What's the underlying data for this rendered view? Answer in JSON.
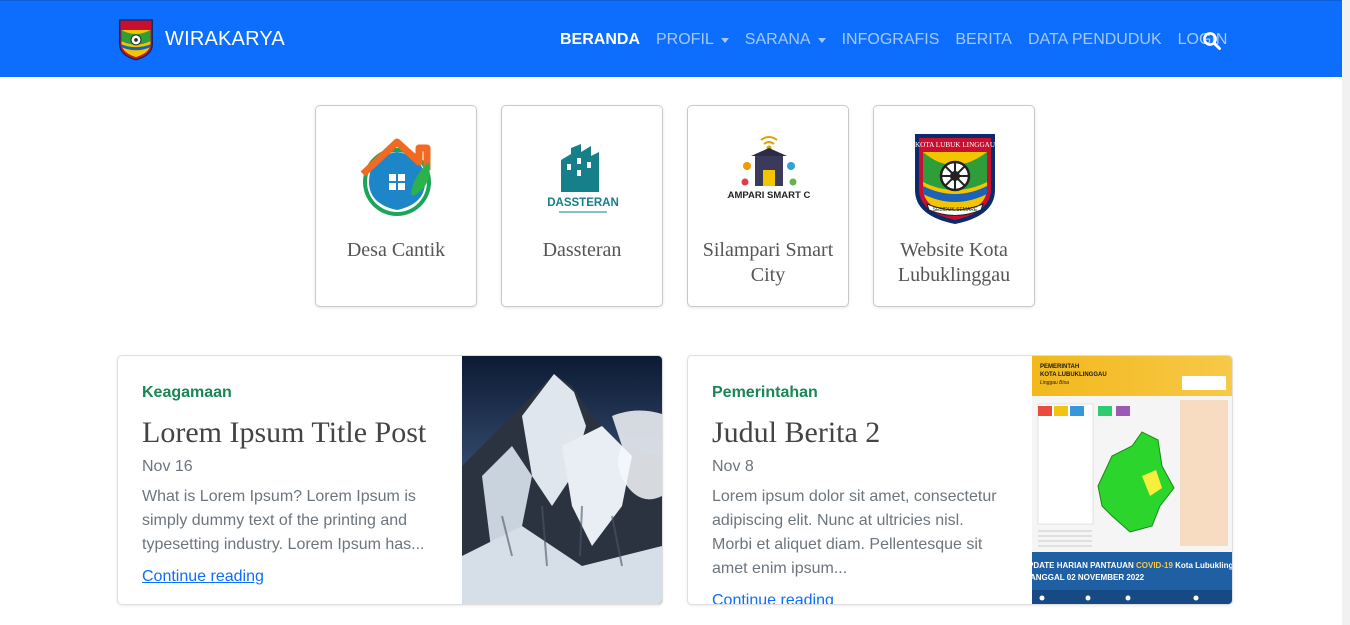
{
  "brand": {
    "name": "WIRAKARYA",
    "logo_icon": "city-crest-icon"
  },
  "nav": {
    "items": [
      {
        "label": "BERANDA",
        "active": true,
        "dropdown": false
      },
      {
        "label": "PROFIL",
        "active": false,
        "dropdown": true
      },
      {
        "label": "SARANA",
        "active": false,
        "dropdown": true
      },
      {
        "label": "INFOGRAFIS",
        "active": false,
        "dropdown": false
      },
      {
        "label": "BERITA",
        "active": false,
        "dropdown": false
      },
      {
        "label": "DATA PENDUDUK",
        "active": false,
        "dropdown": false
      },
      {
        "label": "LOGIN",
        "active": false,
        "dropdown": false
      }
    ],
    "search_icon": "search-icon"
  },
  "apps": [
    {
      "label": "Desa Cantik",
      "icon": "house-leaf-icon"
    },
    {
      "label": "Dassteran",
      "icon": "dassteran-logo-icon",
      "logo_text": "DASSTERAN"
    },
    {
      "label": "Silampari Smart City",
      "icon": "smart-city-icon",
      "logo_text": "SILAMPARI SMART CITY"
    },
    {
      "label": "Website Kota Lubuklinggau",
      "icon": "city-crest-icon",
      "logo_text": "KOTA LUBUK LINGGAU",
      "motto": "SEBIDUK SEMARE"
    }
  ],
  "posts": [
    {
      "category": "Keagamaan",
      "title": "Lorem Ipsum Title Post",
      "date": "Nov 16",
      "excerpt": "What is Lorem Ipsum? Lorem Ipsum is simply dummy text of the printing and typesetting industry. Lorem Ipsum has...",
      "link": "Continue reading",
      "image": "mountain-photo"
    },
    {
      "category": "Pemerintahan",
      "title": "Judul Berita 2",
      "date": "Nov 8",
      "excerpt": "Lorem ipsum dolor sit amet, consectetur adipiscing elit. Nunc at ultricies nisl. Morbi et aliquet diam. Pellentesque sit amet enim ipsum...",
      "link": "Continue reading",
      "image": "covid-infographic-map",
      "image_text": {
        "heading1": "PEMERINTAH",
        "heading2": "KOTA LUBUKLINGGAU",
        "motto": "Linggau Bisa",
        "banner1_a": "PDATE HARIAN PANTAUAN ",
        "banner1_b": "COVID-19",
        "banner1_c": " Kota Lubuklingg",
        "banner2": "ANGGAL 02 NOVEMBER 2022"
      }
    }
  ],
  "colors": {
    "navbar": "#0d6efd",
    "category": "#198754",
    "link": "#0d6efd"
  }
}
